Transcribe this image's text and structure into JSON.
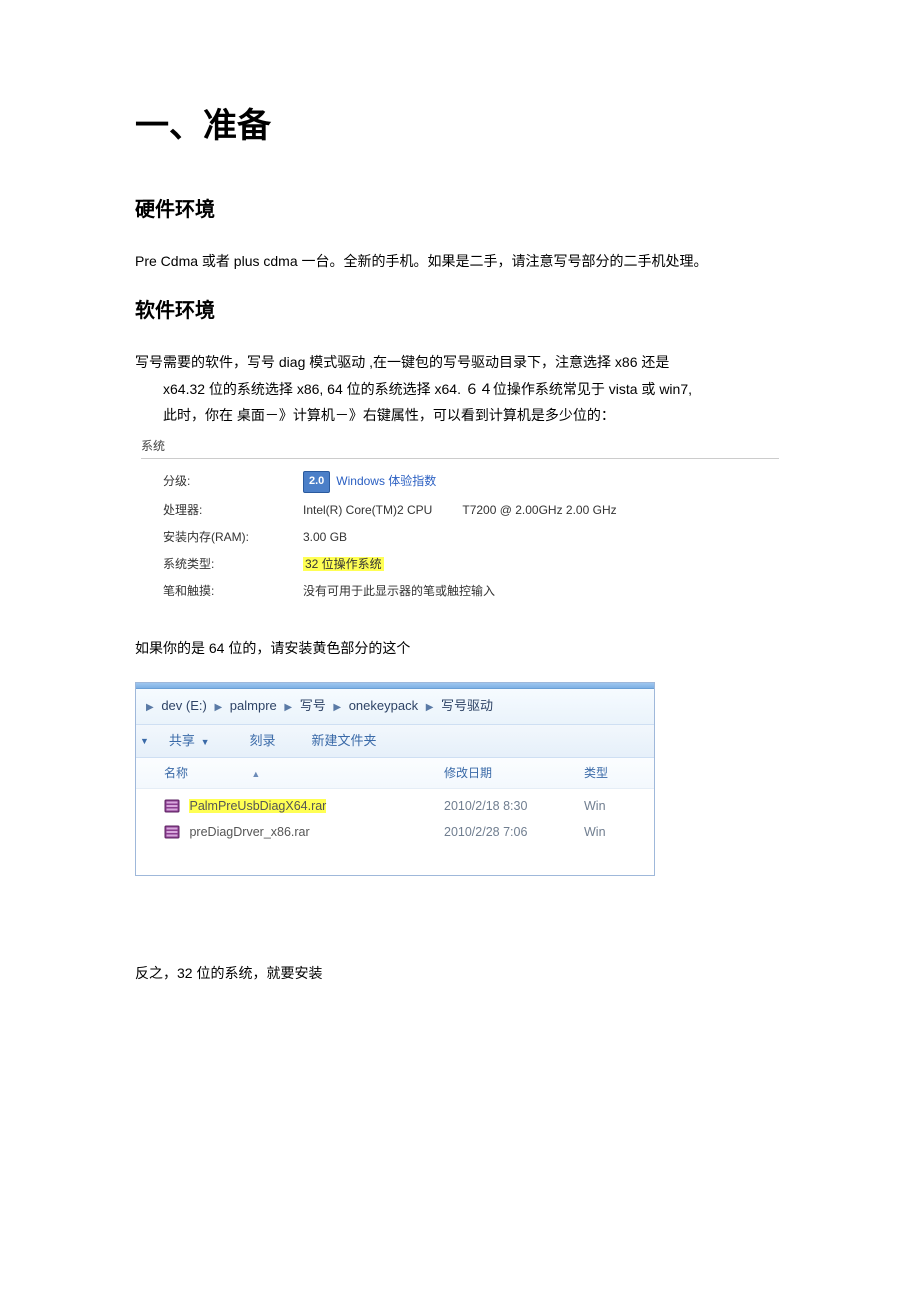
{
  "h1": "一、准备",
  "sec1": {
    "title": "硬件环境",
    "p1": "Pre   Cdma  或者  plus cdma  一台。全新的手机。如果是二手，请注意写号部分的二手机处理。"
  },
  "sec2": {
    "title": "软件环境",
    "p1_l1": "写号需要的软件，写号 diag 模式驱动  ,在一键包的写号驱动目录下，注意选择 x86 还是",
    "p1_l2": "x64.32 位的系统选择 x86, 64 位的系统选择 x64.    ６４位操作系统常见于 vista 或 win7,",
    "p1_l3": "此时，你在   桌面－》计算机－》右键属性，可以看到计算机是多少位的："
  },
  "sys": {
    "header": "系统",
    "rows": {
      "rating_label": "分级:",
      "rating_score": "2.0",
      "rating_link": "Windows 体验指数",
      "cpu_label": "处理器:",
      "cpu_value_a": "Intel(R) Core(TM)2 CPU",
      "cpu_value_b": "T7200  @ 2.00GHz   2.00 GHz",
      "ram_label": "安装内存(RAM):",
      "ram_value": "3.00 GB",
      "type_label": "系统类型:",
      "type_value": "32 位操作系统",
      "pen_label": "笔和触摸:",
      "pen_value": "没有可用于此显示器的笔或触控输入"
    }
  },
  "p_after_sys": "如果你的是 64 位的，请安装黄色部分的这个",
  "explorer": {
    "crumbs": [
      "dev (E:)",
      "palmpre",
      "写号",
      "onekeypack",
      "写号驱动"
    ],
    "toolbar": {
      "share": "共享",
      "burn": "刻录",
      "newfolder": "新建文件夹"
    },
    "cols": {
      "name": "名称",
      "date": "修改日期",
      "type": "类型"
    },
    "rows": [
      {
        "name": "PalmPreUsbDiagX64.rar",
        "date": "2010/2/18 8:30",
        "type": "Win",
        "highlight": true
      },
      {
        "name": "preDiagDrver_x86.rar",
        "date": "2010/2/28 7:06",
        "type": "Win",
        "highlight": false
      }
    ]
  },
  "p_final": "反之，32 位的系统，就要安装"
}
